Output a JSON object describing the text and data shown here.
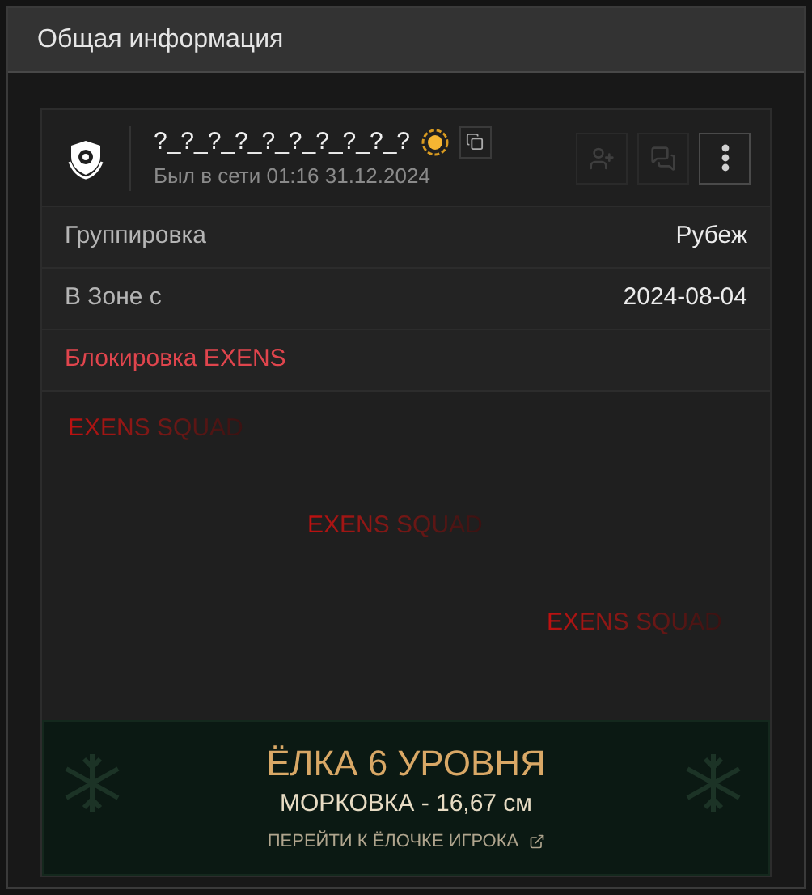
{
  "panel": {
    "title": "Общая информация"
  },
  "profile": {
    "name": "?_?_?_?_?_?_?_?_?_?",
    "last_seen": "Был в сети 01:16 31.12.2024",
    "actions": [
      {
        "kind": "add-friend",
        "disabled": true
      },
      {
        "kind": "message",
        "disabled": true
      },
      {
        "kind": "more",
        "disabled": false
      }
    ]
  },
  "rows": [
    {
      "label": "Группировка",
      "value": "Рубеж"
    },
    {
      "label": "В Зоне с",
      "value": "2024-08-04"
    }
  ],
  "block": {
    "title": "Блокировка EXENS",
    "watermarks": [
      "EXENS SQUAD",
      "EXENS SQUAD",
      "EXENS SQUAD"
    ]
  },
  "tree_banner": {
    "title": "ЁЛКА 6 УРОВНЯ",
    "subtitle": "МОРКОВКА - 16,67 см",
    "link": "ПЕРЕЙТИ К ЁЛОЧКЕ ИГРОКА"
  }
}
